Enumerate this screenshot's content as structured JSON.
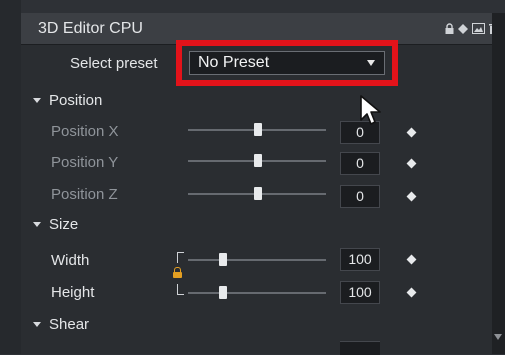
{
  "panel": {
    "title": "3D Editor CPU",
    "header_icons": [
      "lock-icon",
      "diamond-icon",
      "picture-icon",
      "trash-icon",
      "orange-square-icon",
      "menu-icon"
    ]
  },
  "preset": {
    "label": "Select preset",
    "value": "No Preset"
  },
  "sections": {
    "position": {
      "title": "Position",
      "rows": [
        {
          "label": "Position X",
          "value": "0",
          "slider_fraction": 0.5
        },
        {
          "label": "Position Y",
          "value": "0",
          "slider_fraction": 0.5
        },
        {
          "label": "Position Z",
          "value": "0",
          "slider_fraction": 0.5
        }
      ]
    },
    "size": {
      "title": "Size",
      "rows": [
        {
          "label": "Width",
          "value": "100",
          "slider_fraction": 0.2
        },
        {
          "label": "Height",
          "value": "100",
          "slider_fraction": 0.2
        }
      ]
    },
    "shear": {
      "title": "Shear"
    }
  },
  "colors": {
    "highlight": "#e3131a",
    "lock": "#e49f22",
    "accent": "#f07c17"
  }
}
